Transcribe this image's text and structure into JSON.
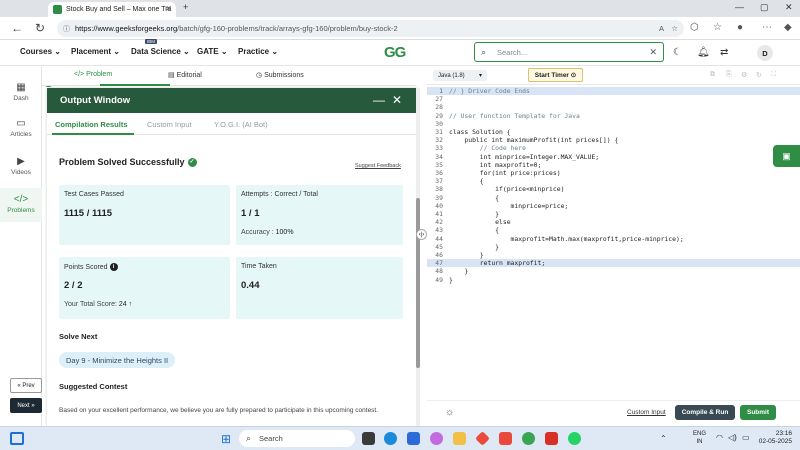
{
  "browser": {
    "tab_title": "Stock Buy and Sell – Max one Tra",
    "url_domain": "https://www.geeksforgeeks.org",
    "url_path": "/batch/gfg-160-problems/track/arrays-gfg-160/problem/buy-stock-2"
  },
  "header": {
    "menus": [
      "Courses",
      "Placement",
      "Data Science",
      "GATE",
      "Practice"
    ],
    "ibm_badge": "IBM",
    "logo": "GG",
    "search_placeholder": "Search...",
    "avatar": "D"
  },
  "sidebar": {
    "items": [
      "Dash",
      "Articles",
      "Videos",
      "Problems"
    ],
    "prev": "« Prev",
    "next": "Next »"
  },
  "problem_tabs": [
    "Problem",
    "Editorial",
    "Submissions"
  ],
  "output": {
    "title": "Output Window",
    "tabs": [
      "Compilation Results",
      "Custom Input",
      "Y.O.G.I. (AI Bot)"
    ],
    "status": "Problem Solved Successfully",
    "suggest_feedback": "Suggest Feedback",
    "cards": {
      "test_cases": {
        "label": "Test Cases Passed",
        "value": "1115 / 1115"
      },
      "attempts": {
        "label": "Attempts : Correct / Total",
        "value": "1 / 1",
        "sub_label": "Accuracy :",
        "sub_value": "100%"
      },
      "points": {
        "label": "Points Scored",
        "value": "2 / 2",
        "sub_label": "Your Total Score:",
        "sub_value": "24 ↑"
      },
      "time": {
        "label": "Time Taken",
        "value": "0.44"
      }
    },
    "solve_next": "Solve Next",
    "next_problem": "Day 9 - Minimize the Heights II",
    "suggested_contest": "Suggested Contest",
    "contest_text": "Based on your excellent performance, we believe you are fully prepared to participate in this upcoming contest."
  },
  "editor": {
    "language": "Java (1.8)",
    "timer": "Start Timer",
    "lines": [
      {
        "n": "1",
        "t": "// } Driver Code Ends",
        "cls": "cm",
        "hl": true
      },
      {
        "n": "27",
        "t": ""
      },
      {
        "n": "28",
        "t": ""
      },
      {
        "n": "29",
        "t": "// User function Template for Java",
        "cls": "cm"
      },
      {
        "n": "30",
        "t": ""
      },
      {
        "n": "31",
        "t": "class Solution {"
      },
      {
        "n": "32",
        "t": "    public int maximumProfit(int prices[]) {"
      },
      {
        "n": "33",
        "t": "        // Code here",
        "cls": "cm"
      },
      {
        "n": "34",
        "t": "        int minprice=Integer.MAX_VALUE;"
      },
      {
        "n": "35",
        "t": "        int maxprofit=0;"
      },
      {
        "n": "36",
        "t": "        for(int price:prices)"
      },
      {
        "n": "37",
        "t": "        {"
      },
      {
        "n": "38",
        "t": "            if(price<minprice)"
      },
      {
        "n": "39",
        "t": "            {"
      },
      {
        "n": "40",
        "t": "                minprice=price;"
      },
      {
        "n": "41",
        "t": "            }"
      },
      {
        "n": "42",
        "t": "            else"
      },
      {
        "n": "43",
        "t": "            {"
      },
      {
        "n": "44",
        "t": "                maxprofit=Math.max(maxprofit,price-minprice);"
      },
      {
        "n": "45",
        "t": "            }"
      },
      {
        "n": "46",
        "t": "        }"
      },
      {
        "n": "47",
        "t": "        return maxprofit;",
        "hl": true
      },
      {
        "n": "48",
        "t": "    }"
      },
      {
        "n": "49",
        "t": "}"
      }
    ],
    "custom_input": "Custom Input",
    "compile_run": "Compile & Run",
    "submit": "Submit"
  },
  "taskbar": {
    "search": "Search",
    "lang_top": "ENG",
    "lang_bottom": "IN",
    "time": "23:16",
    "date": "02-05-2025"
  },
  "colors": {
    "brand": "#2f8d46",
    "output_header": "#27593d",
    "card_bg": "#e6f7f8"
  }
}
